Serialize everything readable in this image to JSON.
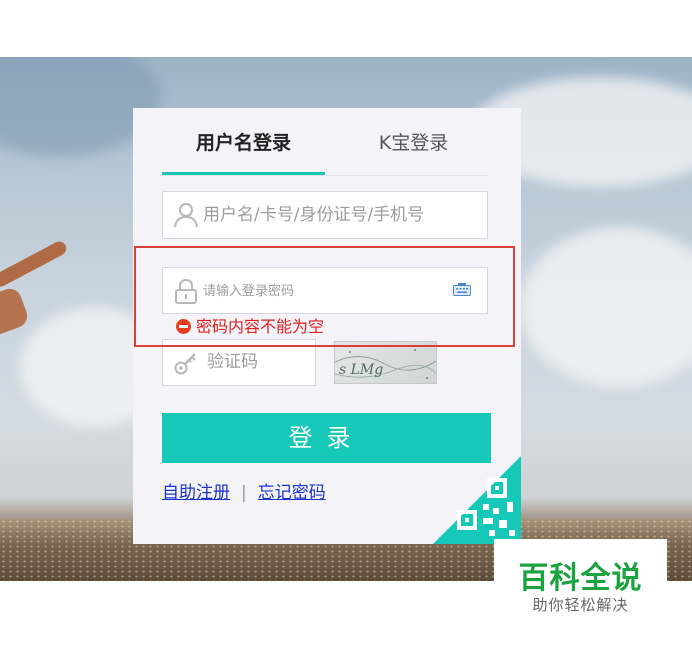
{
  "tabs": {
    "username_login": "用户名登录",
    "kbao_login": "K宝登录"
  },
  "username_field": {
    "placeholder": "用户名/卡号/身份证号/手机号"
  },
  "password_field": {
    "placeholder": "请输入登录密码"
  },
  "error": {
    "message": "密码内容不能为空"
  },
  "captcha_field": {
    "placeholder": "验证码"
  },
  "captcha_image": {
    "text": "s LMg"
  },
  "login_button": {
    "label": "登录"
  },
  "links": {
    "register": "自助注册",
    "separator": "|",
    "forgot_password": "忘记密码"
  },
  "watermark": {
    "title": "百科全说",
    "subtitle": "助你轻松解决"
  },
  "colors": {
    "accent": "#16c8b8",
    "error": "#e02020",
    "link": "#1a33c9",
    "annotation": "#d9403a",
    "watermark_green": "#1ba33f"
  },
  "icons": {
    "username": "user-icon",
    "password": "lock-icon",
    "keyboard": "keyboard-icon",
    "captcha": "key-icon",
    "error": "error-circle-icon",
    "corner": "qr-code-icon"
  }
}
